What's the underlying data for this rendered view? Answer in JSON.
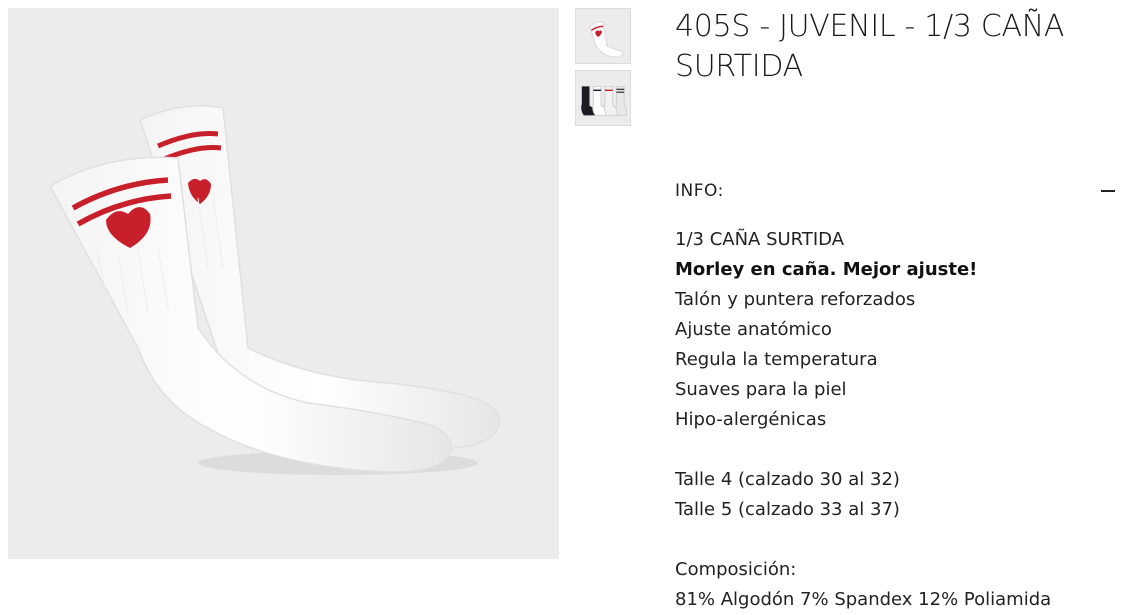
{
  "product": {
    "title": "405S - JUVENIL - 1/3 CAÑA SURTIDA",
    "main_image_icon": "white-socks-red-heart-image",
    "thumbnails": [
      {
        "icon": "white-sock-thumbnail"
      },
      {
        "icon": "assorted-socks-thumbnail"
      }
    ]
  },
  "info": {
    "label": "INFO:",
    "toggle_icon": "minus-icon",
    "lines": [
      "1/3 CAÑA SURTIDA",
      "Morley en caña. Mejor ajuste!",
      "Talón y puntera reforzados",
      "Ajuste anatómico",
      "Regula la temperatura",
      "Suaves para la piel",
      "Hipo-alergénicas"
    ],
    "sizes": [
      "Talle 4 (calzado 30 al 32)",
      "Talle 5 (calzado 33 al 37)"
    ],
    "composition_label": "Composición:",
    "composition": "81% Algodón 7% Spandex 12% Poliamida"
  },
  "colors": {
    "accent_red": "#c8202b",
    "image_bg": "#ececec"
  }
}
